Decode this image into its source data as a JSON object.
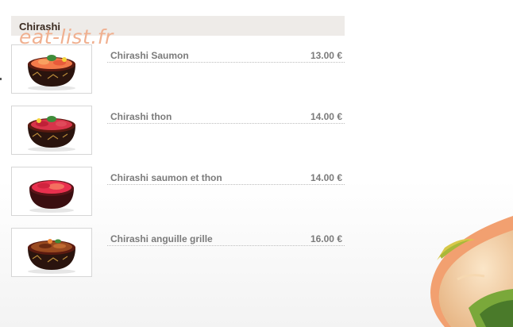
{
  "section": {
    "title": "Chirashi"
  },
  "watermark": "eat-list.fr",
  "items": [
    {
      "name": "Chirashi Saumon",
      "price": "13.00 €",
      "icon": "chirashi-salmon-bowl"
    },
    {
      "name": "Chirashi thon",
      "price": "14.00 €",
      "icon": "chirashi-tuna-bowl"
    },
    {
      "name": "Chirashi saumon et thon",
      "price": "14.00 €",
      "icon": "chirashi-salmon-tuna-bowl"
    },
    {
      "name": "Chirashi anguille grille",
      "price": "16.00 €",
      "icon": "chirashi-eel-bowl"
    }
  ],
  "colors": {
    "header_bg": "#eeebe8",
    "title": "#3a2a20",
    "item_text": "#7b7b7b",
    "watermark": "#f0b090"
  }
}
